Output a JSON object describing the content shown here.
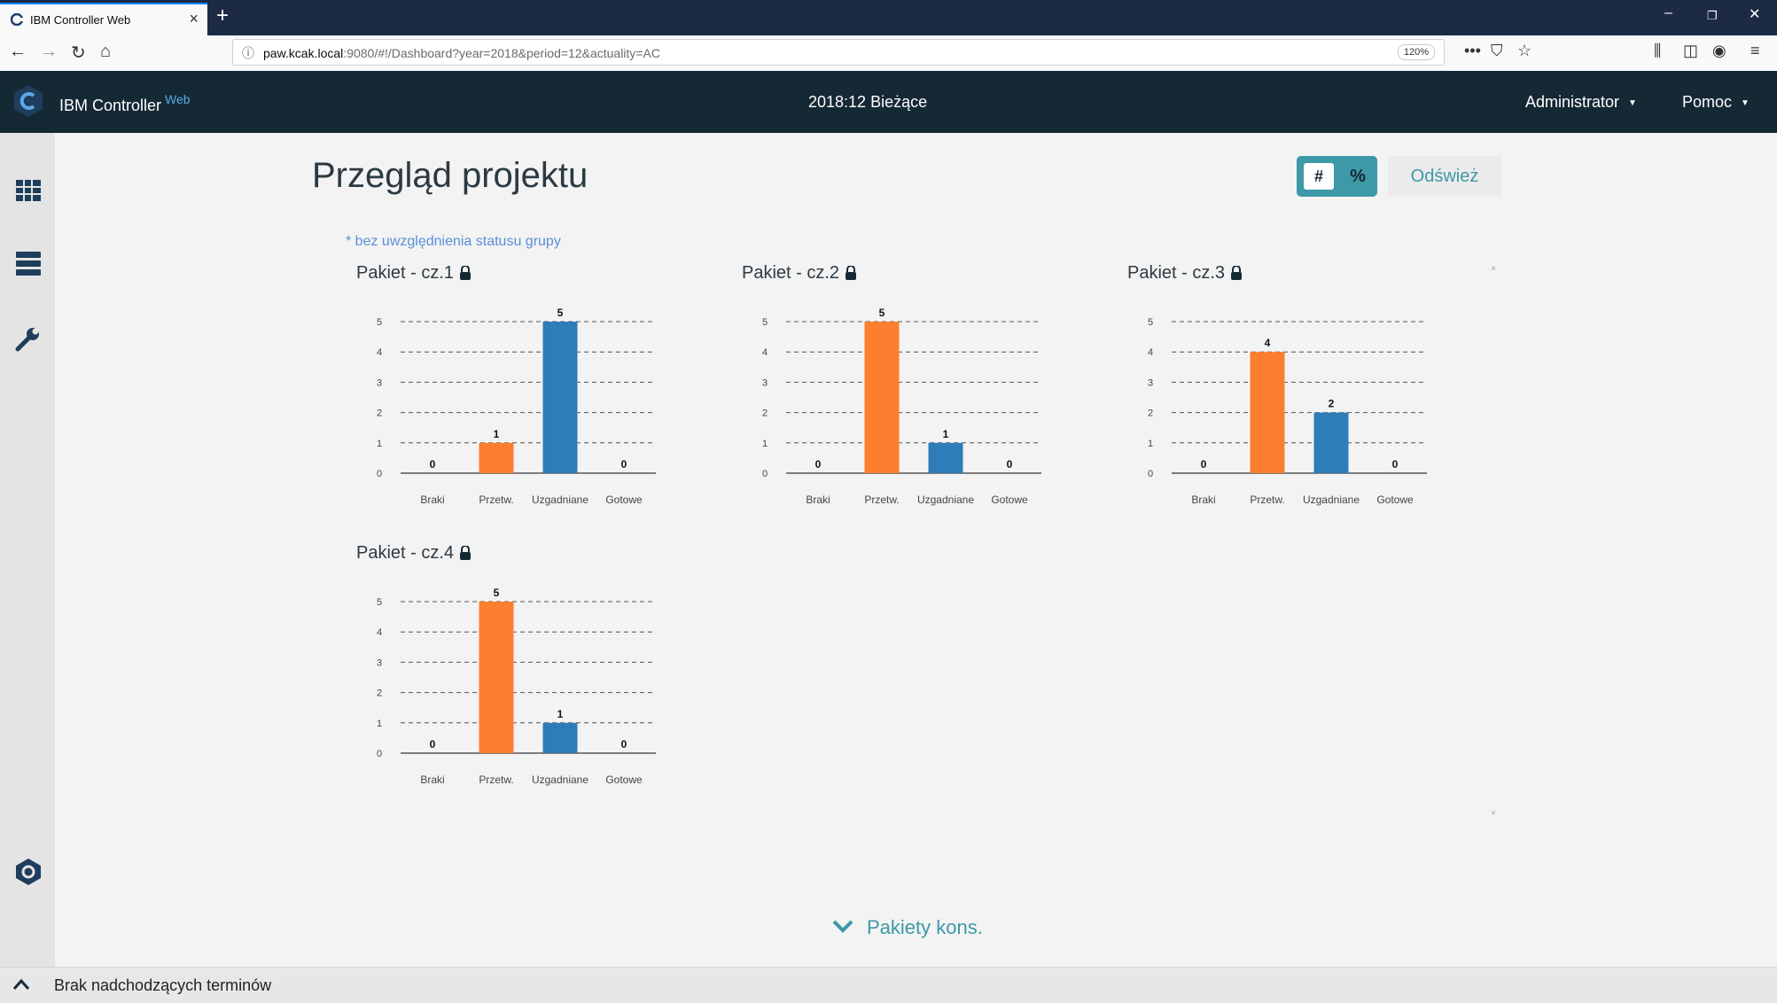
{
  "browser": {
    "tab_title": "IBM Controller Web",
    "new_tab": "+",
    "url_host": "paw.kcak.local",
    "url_rest": ":9080/#!/Dashboard?year=2018&period=12&actuality=AC",
    "zoom": "120%",
    "page_actions": "•••"
  },
  "app": {
    "name": "IBM Controller",
    "name_suffix": "Web",
    "period": "2018:12 Bieżące",
    "user_menu": "Administrator",
    "help_menu": "Pomoc"
  },
  "main": {
    "title": "Przegląd projektu",
    "toggle_hash": "#",
    "toggle_percent": "%",
    "refresh": "Odśwież",
    "note": "* bez uwzględnienia statusu grupy",
    "section_toggle": "Pakiety kons."
  },
  "footer": {
    "text": "Brak nadchodzących terminów"
  },
  "colors": {
    "orange": "#fd7e2e",
    "blue": "#2e7cb8",
    "header": "#152935",
    "accent": "#3d99a7"
  },
  "chart_data": [
    {
      "type": "bar",
      "title": "Pakiet - cz.1",
      "categories": [
        "Braki",
        "Przetw.",
        "Uzgadniane",
        "Gotowe"
      ],
      "values": [
        0,
        1,
        5,
        0
      ],
      "ylim": [
        0,
        5
      ],
      "grid": true
    },
    {
      "type": "bar",
      "title": "Pakiet - cz.2",
      "categories": [
        "Braki",
        "Przetw.",
        "Uzgadniane",
        "Gotowe"
      ],
      "values": [
        0,
        5,
        1,
        0
      ],
      "ylim": [
        0,
        5
      ],
      "grid": true
    },
    {
      "type": "bar",
      "title": "Pakiet - cz.3",
      "categories": [
        "Braki",
        "Przetw.",
        "Uzgadniane",
        "Gotowe"
      ],
      "values": [
        0,
        4,
        2,
        0
      ],
      "ylim": [
        0,
        5
      ],
      "grid": true
    },
    {
      "type": "bar",
      "title": "Pakiet - cz.4",
      "categories": [
        "Braki",
        "Przetw.",
        "Uzgadniane",
        "Gotowe"
      ],
      "values": [
        0,
        5,
        1,
        0
      ],
      "ylim": [
        0,
        5
      ],
      "grid": true
    }
  ]
}
